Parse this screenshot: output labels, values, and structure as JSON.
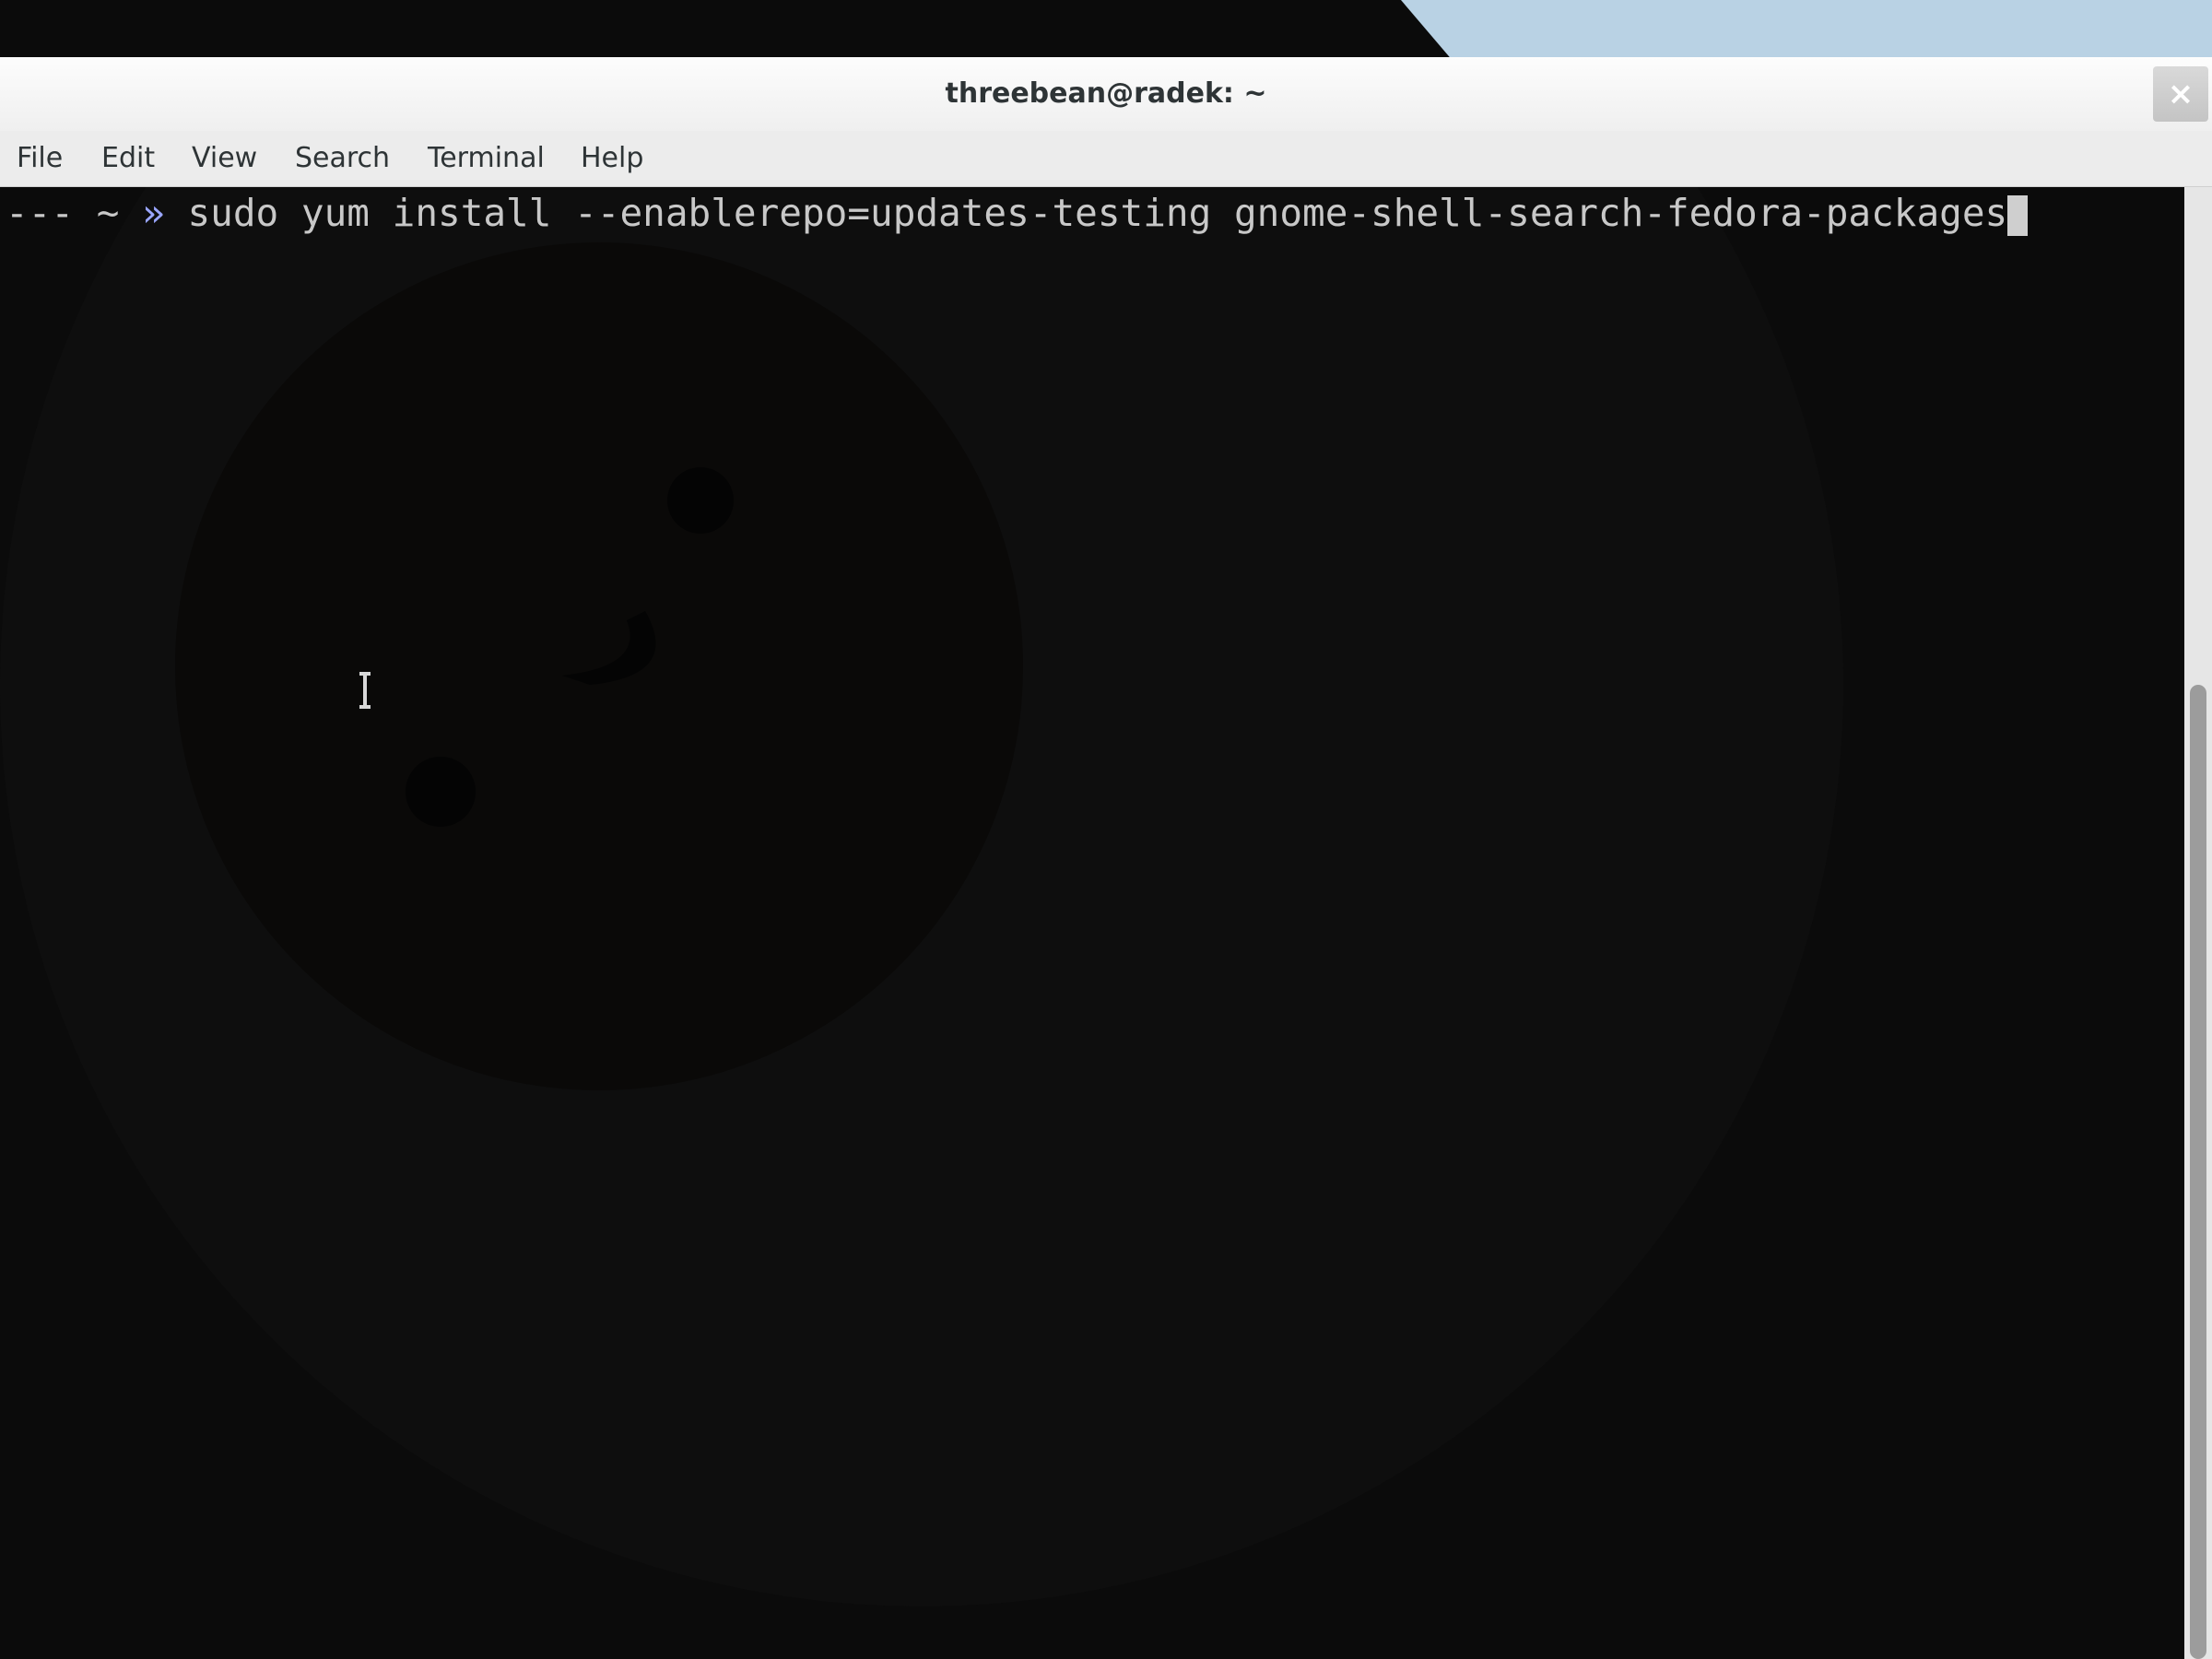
{
  "window": {
    "title": "threebean@radek: ~",
    "close_label": "×"
  },
  "menu": {
    "items": [
      {
        "label": "File"
      },
      {
        "label": "Edit"
      },
      {
        "label": "View"
      },
      {
        "label": "Search"
      },
      {
        "label": "Terminal"
      },
      {
        "label": "Help"
      }
    ]
  },
  "terminal": {
    "prompt_prefix": "--- ~ ",
    "prompt_arrow": "»",
    "command": "sudo yum install --enablerepo=updates-testing gnome-shell-search-fedora-packages"
  },
  "icons": {
    "close": "close-icon",
    "text_cursor": "text-cursor-icon"
  },
  "colors": {
    "terminal_bg": "#0b0b0b",
    "terminal_fg": "#c8c8c8",
    "prompt_arrow": "#9aa6ff",
    "titlebar_bg": "#f4f4f4",
    "accent_blue": "#b9d2e4"
  }
}
